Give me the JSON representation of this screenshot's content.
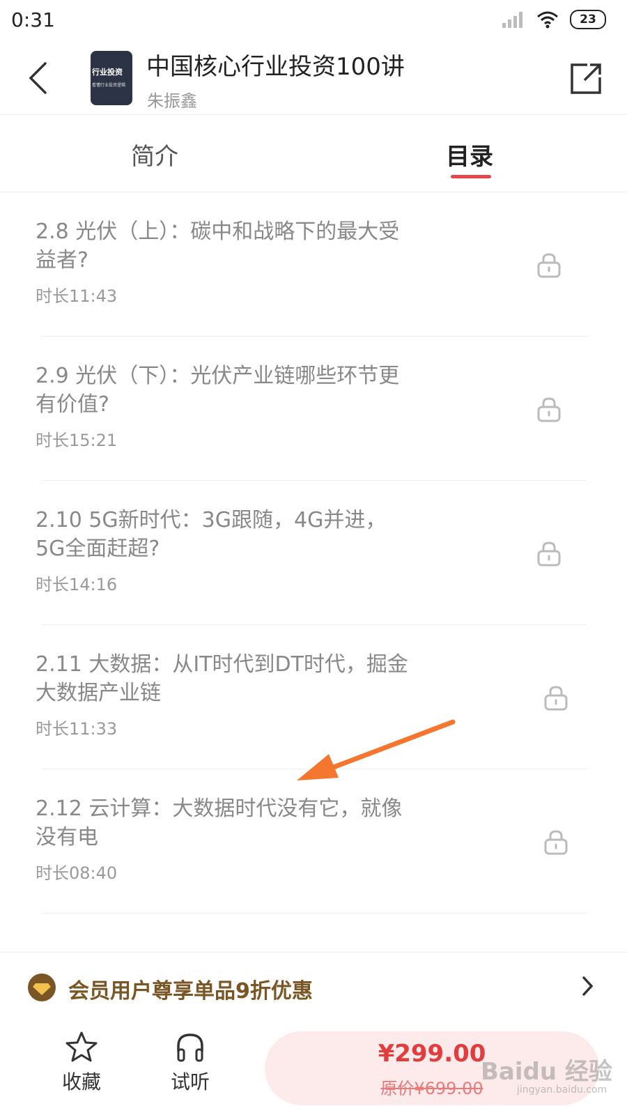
{
  "status_bar": {
    "time": "0:31",
    "battery": "23"
  },
  "header": {
    "back_icon": "chevron-left-icon",
    "cover": {
      "title": "行业投资",
      "subtitle": "看懂行业投资逻辑"
    },
    "title": "中国核心行业投资100讲",
    "author": "朱振鑫",
    "share_icon": "share-icon"
  },
  "tabs": [
    {
      "label": "简介",
      "active": false
    },
    {
      "label": "目录",
      "active": true
    }
  ],
  "lessons": [
    {
      "title": "2.8 光伏（上）：碳中和战略下的最大受益者?",
      "duration": "时长11:43",
      "locked": true
    },
    {
      "title": "2.9 光伏（下）：光伏产业链哪些环节更有价值?",
      "duration": "时长15:21",
      "locked": true
    },
    {
      "title": "2.10 5G新时代：3G跟随，4G并进，5G全面赶超?",
      "duration": "时长14:16",
      "locked": true
    },
    {
      "title": "2.11 大数据：从IT时代到DT时代，掘金大数据产业链",
      "duration": "时长11:33",
      "locked": true
    },
    {
      "title": "2.12 云计算：大数据时代没有它，就像没有电",
      "duration": "时长08:40",
      "locked": true
    }
  ],
  "promo": {
    "text": "会员用户尊享单品9折优惠"
  },
  "bottom_bar": {
    "favorite_label": "收藏",
    "listen_label": "试听",
    "price": "¥299.00",
    "original_price": "原价¥699.00"
  },
  "watermark": {
    "text": "Baidu 经验",
    "url": "jingyan.baidu.com"
  },
  "colors": {
    "accent": "#e8474a",
    "price": "#e23c3c",
    "promo": "#7a5624",
    "arrow": "#f4762f"
  }
}
